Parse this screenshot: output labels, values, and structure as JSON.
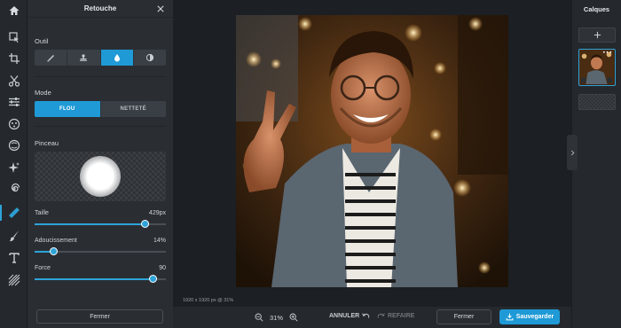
{
  "panel": {
    "title": "Retouche",
    "outil_label": "Outil",
    "mode_label": "Mode",
    "mode_options": [
      "FLOU",
      "NETTETÉ"
    ],
    "pinceau_label": "Pinceau",
    "sliders": [
      {
        "label": "Taille",
        "value_text": "429px",
        "fraction": 0.84
      },
      {
        "label": "Adoucissement",
        "value_text": "14%",
        "fraction": 0.14
      },
      {
        "label": "Force",
        "value_text": "90",
        "fraction": 0.9
      }
    ],
    "fermer": "Fermer"
  },
  "canvas": {
    "dimensions": "1920 x 1920 px @ 31%"
  },
  "bottom": {
    "zoom": "31%",
    "annuler": "ANNULER",
    "refaire": "REFAIRE",
    "fermer": "Fermer",
    "sauvegarder": "Sauvegarder"
  },
  "layers": {
    "title": "Calques"
  },
  "colors": {
    "accent": "#1f9ad6",
    "panel_bg": "#2a2e33",
    "canvas_bg": "#1c1f23"
  },
  "icons": {
    "rail": [
      "home-icon",
      "pointer-icon",
      "crop-icon",
      "scissors-icon",
      "adjust-icon",
      "filter-icon",
      "effects-icon",
      "spiral-icon",
      "brush-icon",
      "paint-icon",
      "text-icon",
      "texture-icon"
    ],
    "outil": [
      "pencil-icon",
      "stamp-icon",
      "drop-icon",
      "halftone-icon"
    ]
  }
}
